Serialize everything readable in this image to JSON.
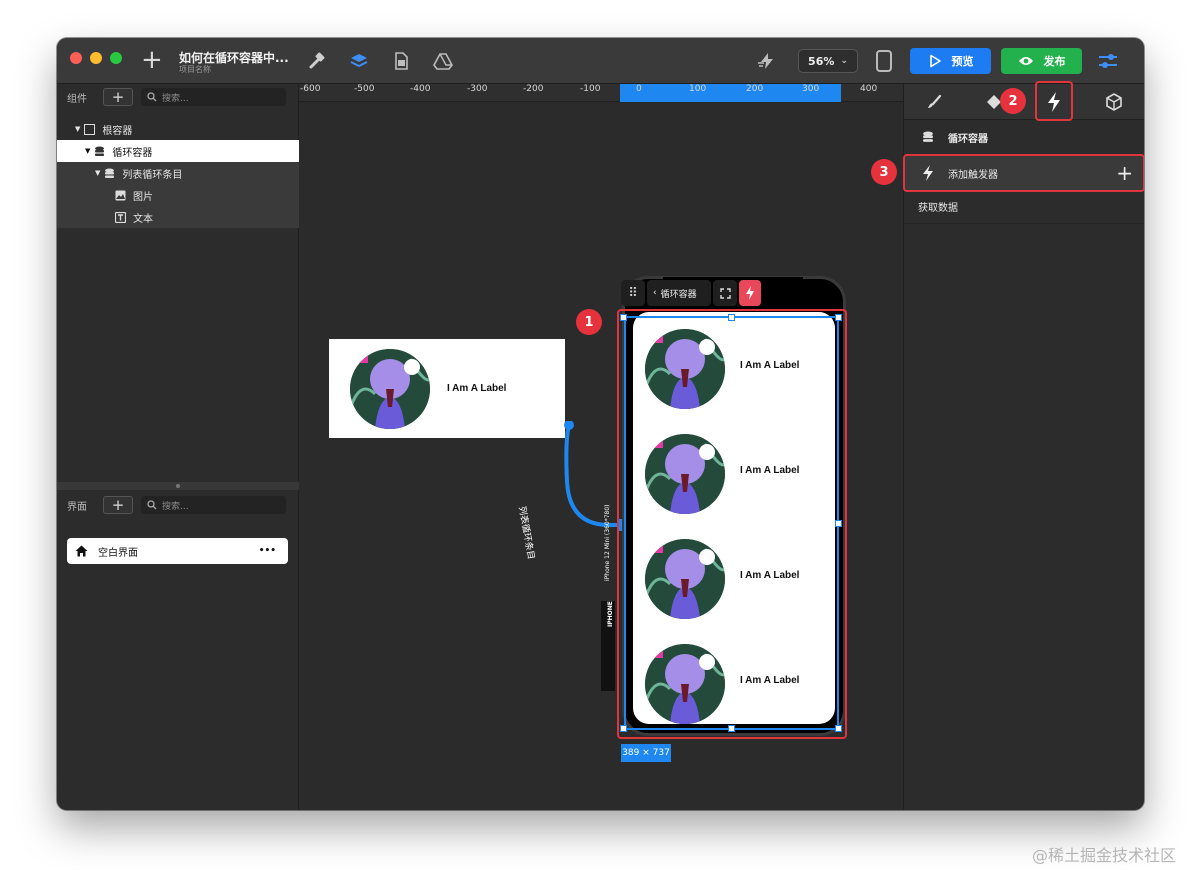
{
  "titlebar": {
    "project_title": "如何在循环容器中...",
    "project_subtitle": "项目名称",
    "zoom": "56%",
    "preview_label": "预览",
    "publish_label": "发布"
  },
  "components_panel": {
    "label": "组件",
    "add": "+",
    "search_placeholder": "搜索...",
    "tree": [
      {
        "label": "根容器"
      },
      {
        "label": "循环容器"
      },
      {
        "label": "列表循环条目"
      },
      {
        "label": "图片"
      },
      {
        "label": "文本"
      }
    ]
  },
  "screens_panel": {
    "label": "界面",
    "add": "+",
    "search_placeholder": "搜索...",
    "page_name": "空白界面",
    "more": "•••"
  },
  "ruler": {
    "ticks": [
      "-600",
      "-500",
      "-400",
      "-300",
      "-200",
      "-100",
      "0",
      "100",
      "200",
      "300",
      "400"
    ]
  },
  "canvas": {
    "component_label": "I Am A Label",
    "connector_label": "列表循环条目",
    "device_label": "iPhone 12 Mini (360*780)",
    "device_brand": "IPHONE",
    "container_chip": "循环容器",
    "size_chip": "389 × 737",
    "list_labels": [
      "I Am A Label",
      "I Am A Label",
      "I Am A Label",
      "I Am A Label"
    ]
  },
  "right_panel": {
    "component_name": "循环容器",
    "add_trigger": "添加触发器",
    "fetch_data": "获取数据"
  },
  "badges": [
    "1",
    "2",
    "3"
  ],
  "watermark": "@稀土掘金技术社区",
  "colors": {
    "accent_blue": "#1e7cf2",
    "publish_green": "#23b14d",
    "highlight_red": "#e0343e"
  }
}
